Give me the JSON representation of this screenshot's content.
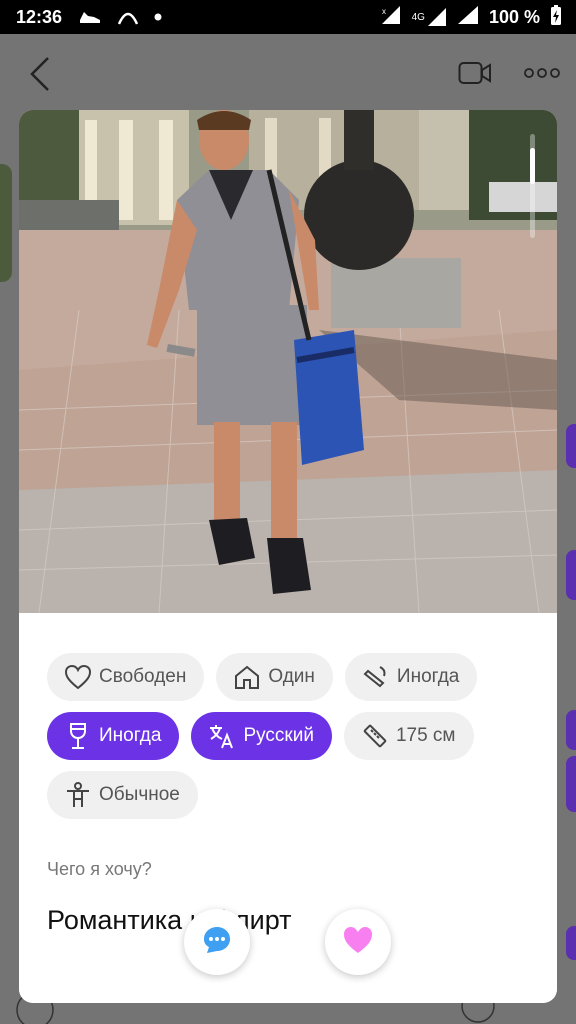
{
  "status_bar": {
    "time": "12:36",
    "battery_label": "100 %",
    "network_label": "4G",
    "icons": [
      "shoe-icon",
      "app-arc-icon",
      "dot-icon",
      "signal-x-icon",
      "signal-4g-icon",
      "signal-icon",
      "battery-charging-icon"
    ]
  },
  "header": {
    "back_icon": "chevron-left-icon",
    "video_icon": "video-camera-icon",
    "more_icon": "more-dots-icon"
  },
  "profile": {
    "chips": [
      {
        "label": "Свободен",
        "icon": "heart-outline-icon",
        "active": false
      },
      {
        "label": "Один",
        "icon": "house-icon",
        "active": false
      },
      {
        "label": "Иногда",
        "icon": "cigarette-icon",
        "active": false
      },
      {
        "label": "Иногда",
        "icon": "wine-glass-icon",
        "active": true
      },
      {
        "label": "Русский",
        "icon": "translate-icon",
        "active": true
      },
      {
        "label": "175 см",
        "icon": "ruler-icon",
        "active": false
      },
      {
        "label": "Обычное",
        "icon": "body-type-icon",
        "active": false
      }
    ],
    "want_label": "Чего я хочу?",
    "want_value": "Романтика и флирт"
  },
  "actions": {
    "chat_icon": "chat-bubble-icon",
    "like_icon": "heart-filled-icon"
  },
  "colors": {
    "accent": "#6c33e6",
    "chip_bg": "#f0f0f0",
    "like_pink": "#f77ff0",
    "chat_blue": "#3f9ff0"
  }
}
